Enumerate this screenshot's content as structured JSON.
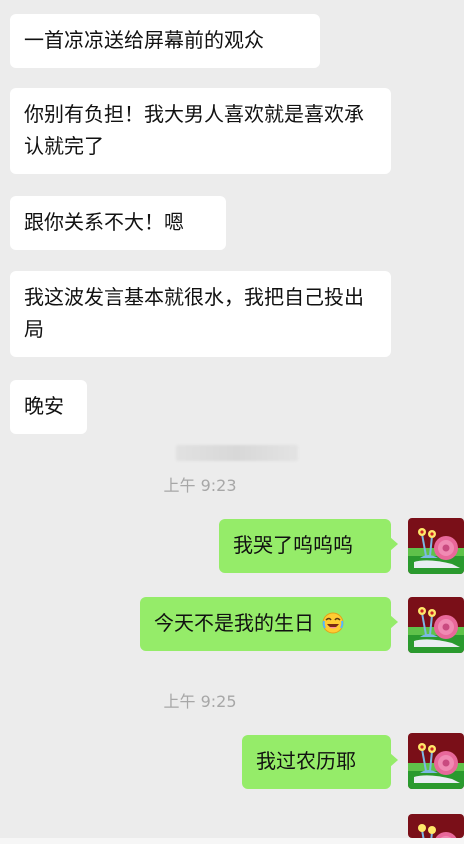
{
  "messages_in": [
    {
      "text": "一首凉凉送给屏幕前的观众"
    },
    {
      "text": "你别有负担！我大男人喜欢就是喜欢承认就完了"
    },
    {
      "text": "跟你关系不大！嗯"
    },
    {
      "text": "我这波发言基本就很水，我把自己投出局"
    },
    {
      "text": "晚安"
    }
  ],
  "timestamps": [
    {
      "text": "上午 9:23"
    },
    {
      "text": "上午 9:25"
    }
  ],
  "messages_out": [
    {
      "text": "我哭了呜呜呜"
    },
    {
      "text": "今天不是我的生日"
    },
    {
      "text": "我过农历耶"
    }
  ],
  "icons": {
    "laughing_emoji": "face-with-tears-of-joy-icon",
    "avatar": "snail-avatar-icon"
  },
  "colors": {
    "background": "#ececec",
    "incoming_bubble": "#ffffff",
    "outgoing_bubble": "#95ec69",
    "timestamp": "#a7a7a7"
  }
}
